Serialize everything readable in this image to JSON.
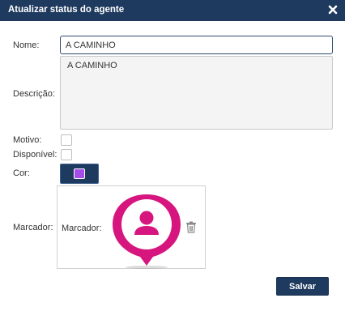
{
  "dialog": {
    "title": "Atualizar status do agente",
    "close_icon": "close-icon"
  },
  "form": {
    "nome_label": "Nome:",
    "nome_value": "A CAMINHO",
    "descricao_label": "Descrição:",
    "descricao_value": "A CAMINHO",
    "motivo_label": "Motivo:",
    "motivo_checked": false,
    "disponivel_label": "Disponível:",
    "disponivel_checked": false,
    "cor_label": "Cor:",
    "cor_value": "#a64de8",
    "marcador_label": "Marcador:",
    "marcador_inner_label": "Marcador:",
    "marcador_icon": "map-pin-person-icon",
    "marcador_color": "#d6167e",
    "delete_icon": "trash-icon"
  },
  "actions": {
    "save_label": "Salvar"
  },
  "colors": {
    "header": "#1f3a5f",
    "accent_pink": "#d6167e",
    "swatch_purple": "#a64de8"
  }
}
